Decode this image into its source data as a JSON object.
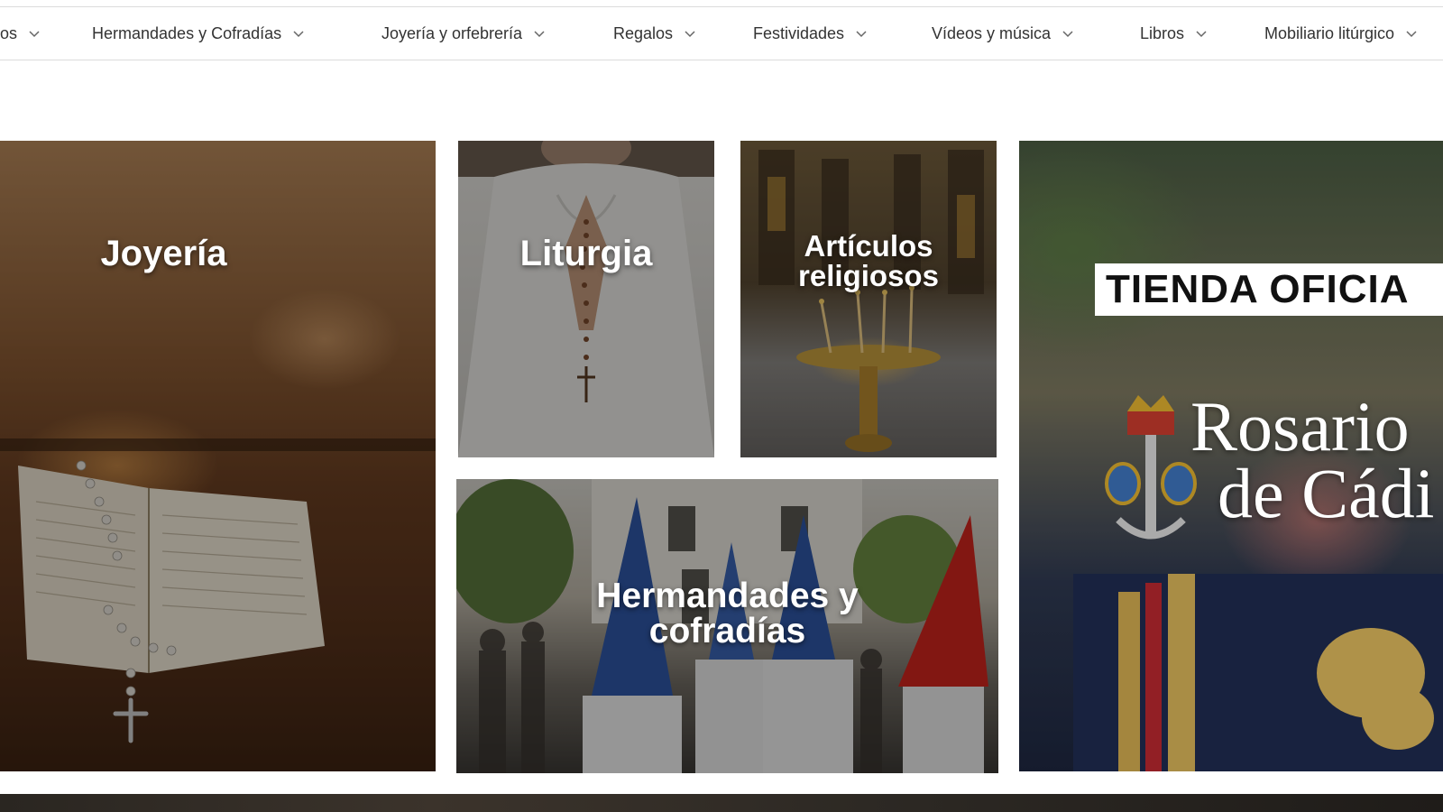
{
  "nav": {
    "items": [
      {
        "label": "os"
      },
      {
        "label": "Hermandades y Cofradías"
      },
      {
        "label": "Joyería y orfebrería"
      },
      {
        "label": "Regalos"
      },
      {
        "label": "Festividades"
      },
      {
        "label": "Vídeos y música"
      },
      {
        "label": "Libros"
      },
      {
        "label": "Mobiliario litúrgico"
      }
    ]
  },
  "tiles": {
    "joyeria": {
      "title": "Joyería"
    },
    "liturgia": {
      "title": "Liturgia"
    },
    "articulos": {
      "title_line1": "Artículos",
      "title_line2": "religiosos"
    },
    "hermandades": {
      "title_line1": "Hermandades y",
      "title_line2": "cofradías"
    },
    "rosario": {
      "badge": "TIENDA OFICIA",
      "brand_line1": "Rosario",
      "brand_line2": "de Cádi"
    }
  },
  "colors": {
    "nav_text": "#333333",
    "nav_border": "#dcdcdc",
    "overlay_text": "#ffffff",
    "crown_red": "#c0392b",
    "gold": "#d4a72c",
    "navy": "#1f2a4a"
  }
}
